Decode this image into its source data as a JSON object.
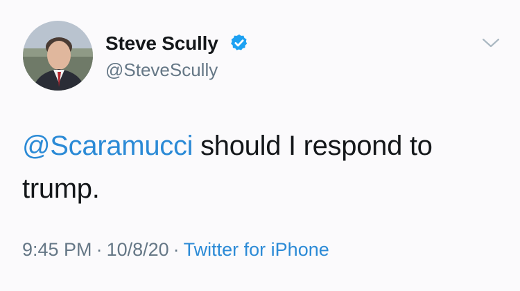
{
  "user": {
    "display_name": "Steve Scully",
    "handle": "@SteveScully",
    "verified": true
  },
  "tweet": {
    "mention": "@Scaramucci",
    "text": " should I respond to trump."
  },
  "meta": {
    "time": "9:45 PM",
    "separator": "·",
    "date": "10/8/20",
    "source": "Twitter for iPhone"
  },
  "icons": {
    "verified": "verified-badge-icon",
    "caret": "chevron-down-icon"
  },
  "colors": {
    "link": "#2b8ad6",
    "secondary_text": "#657786",
    "primary_text": "#14171a",
    "verified": "#1da1f2",
    "background": "#fbfafc"
  }
}
